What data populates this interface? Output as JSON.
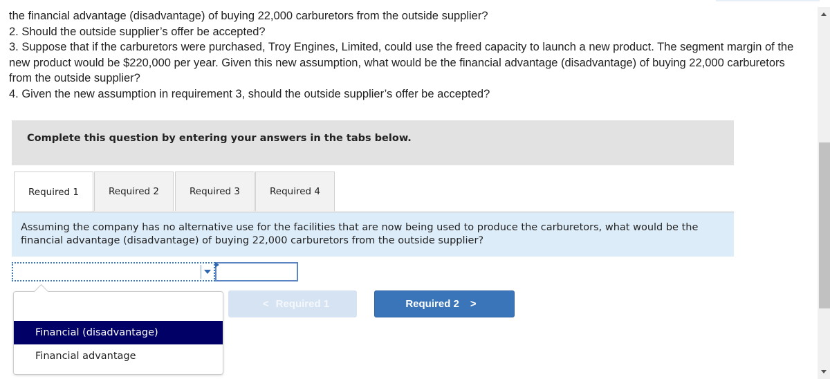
{
  "question": {
    "lines": [
      "the financial advantage (disadvantage) of buying 22,000 carburetors from the outside supplier?",
      "2. Should the outside supplier’s offer be accepted?",
      "3. Suppose that if the carburetors were purchased, Troy Engines, Limited, could use the freed capacity to launch a new product. The segment margin of the new product would be $220,000 per year. Given this new assumption, what would be the financial advantage (disadvantage) of buying 22,000 carburetors from the outside supplier?",
      "4. Given the new assumption in requirement 3, should the outside supplier’s offer be accepted?"
    ]
  },
  "instruction": "Complete this question by entering your answers in the tabs below.",
  "tabs": [
    {
      "label": "Required 1",
      "active": true
    },
    {
      "label": "Required 2",
      "active": false
    },
    {
      "label": "Required 3",
      "active": false
    },
    {
      "label": "Required 4",
      "active": false
    }
  ],
  "prompt": "Assuming the company has no alternative use for the facilities that are now being used to produce the carburetors, what would be the financial advantage (disadvantage) of buying 22,000 carburetors from the outside supplier?",
  "answer": {
    "select_value": "",
    "amount_value": ""
  },
  "dropdown": {
    "options": [
      "",
      "Financial (disadvantage)",
      "Financial advantage"
    ],
    "highlighted": "Financial (disadvantage)"
  },
  "nav": {
    "prev_label": "Required 1",
    "next_label": "Required 2",
    "prev_icon": "chevron-left-icon",
    "next_icon": "chevron-right-icon"
  },
  "colors": {
    "highlight": "#000066",
    "next_button": "#3a74b9",
    "prev_button_disabled": "#d6e3f2",
    "prompt_bg": "#dcecf9",
    "instruction_bg": "#e2e2e2"
  }
}
